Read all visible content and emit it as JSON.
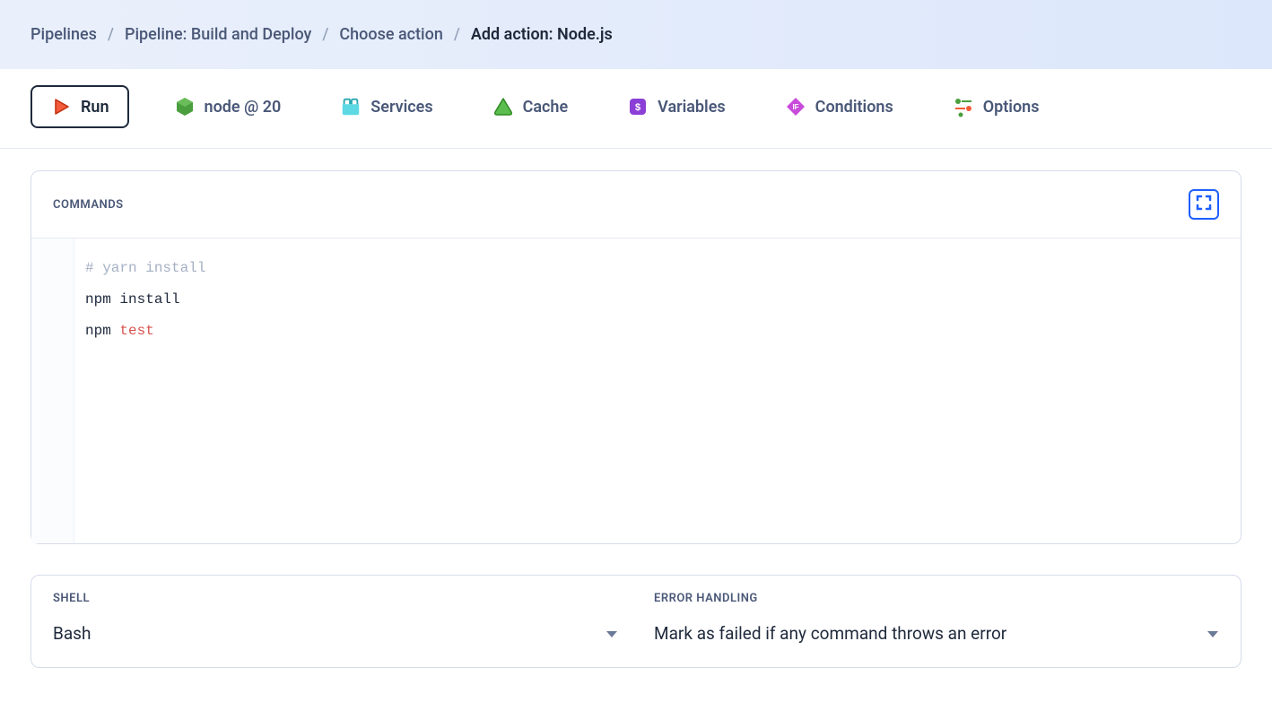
{
  "breadcrumb": {
    "items": [
      "Pipelines",
      "Pipeline: Build and Deploy",
      "Choose action"
    ],
    "current": "Add action: Node.js"
  },
  "tabs": {
    "run": "Run",
    "node": "node @ 20",
    "services": "Services",
    "cache": "Cache",
    "variables": "Variables",
    "conditions": "Conditions",
    "options": "Options"
  },
  "commands": {
    "label": "COMMANDS",
    "lines": [
      {
        "type": "comment",
        "text": "# yarn install"
      },
      {
        "type": "plain",
        "text": "npm install"
      },
      {
        "type": "mixed",
        "prefix": "npm ",
        "keyword": "test"
      }
    ]
  },
  "shell": {
    "label": "SHELL",
    "value": "Bash"
  },
  "error_handling": {
    "label": "ERROR HANDLING",
    "value": "Mark as failed if any command throws an error"
  }
}
